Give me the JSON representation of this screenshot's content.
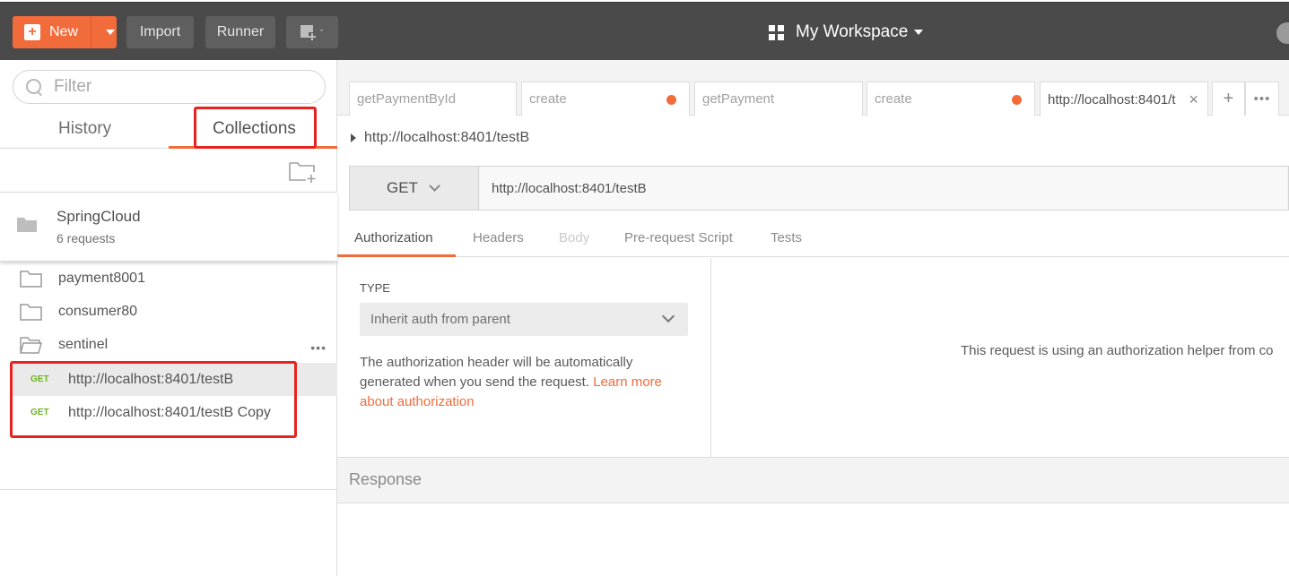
{
  "header": {
    "new_label": "New",
    "import_label": "Import",
    "runner_label": "Runner",
    "workspace_label": "My Workspace"
  },
  "sidebar": {
    "filter_placeholder": "Filter",
    "tabs": [
      {
        "label": "History",
        "active": false
      },
      {
        "label": "Collections",
        "active": true
      }
    ],
    "collection": {
      "name": "SpringCloud",
      "count": "6 requests"
    },
    "folders": [
      {
        "label": "payment8001",
        "open": false
      },
      {
        "label": "consumer80",
        "open": false
      },
      {
        "label": "sentinel",
        "open": true
      }
    ],
    "requests": [
      {
        "method": "GET",
        "label": "http://localhost:8401/testB",
        "active": true
      },
      {
        "method": "GET",
        "label": "http://localhost:8401/testB Copy",
        "active": false
      }
    ]
  },
  "tabs": [
    {
      "label": "getPaymentById",
      "unsaved": false
    },
    {
      "label": "create",
      "unsaved": true
    },
    {
      "label": "getPayment",
      "unsaved": false
    },
    {
      "label": "create",
      "unsaved": true
    },
    {
      "label": "http://localhost:8401/t",
      "active": true
    }
  ],
  "request": {
    "breadcrumb": "http://localhost:8401/testB",
    "method": "GET",
    "url": "http://localhost:8401/testB"
  },
  "request_tabs": [
    {
      "label": "Authorization",
      "state": "active"
    },
    {
      "label": "Headers",
      "state": "normal"
    },
    {
      "label": "Body",
      "state": "disabled"
    },
    {
      "label": "Pre-request Script",
      "state": "normal"
    },
    {
      "label": "Tests",
      "state": "normal"
    }
  ],
  "auth": {
    "type_label": "TYPE",
    "type_value": "Inherit auth from parent",
    "description": "The authorization header will be automatically generated when you send the request. ",
    "link": "Learn more about authorization",
    "helper_msg": "This request is using an authorization helper from co"
  },
  "response": {
    "label": "Response"
  },
  "colors": {
    "accent": "#f26b3a",
    "header_bg": "#4a4a4a",
    "get_method": "#6bb323",
    "highlight_box": "#e8231f"
  }
}
